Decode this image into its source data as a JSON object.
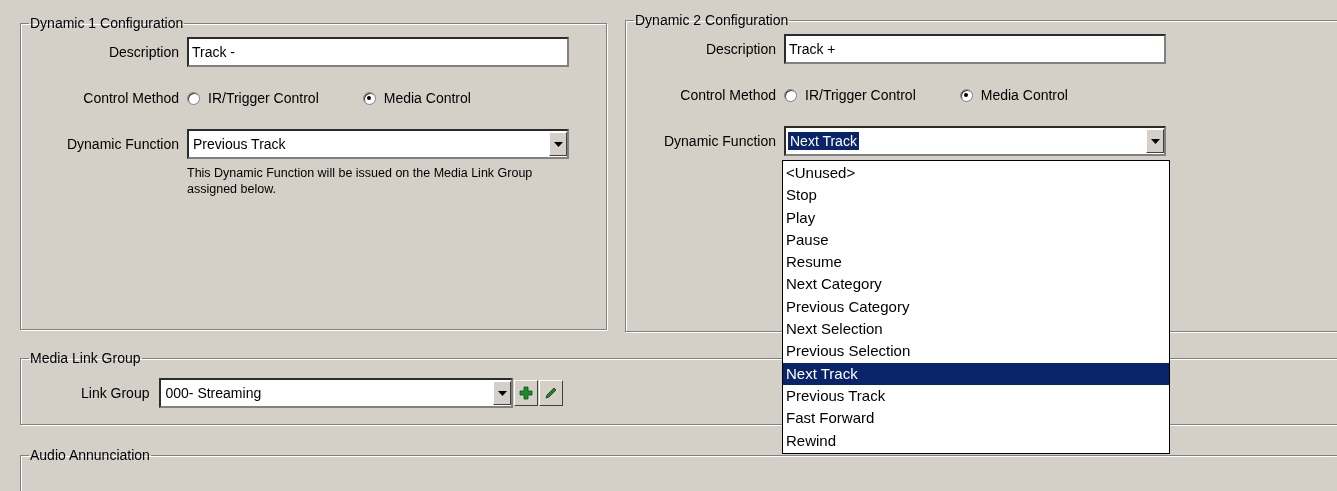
{
  "groups": [
    {
      "title": "Dynamic 1 Configuration",
      "description": {
        "label": "Description",
        "value": "Track -"
      },
      "control_method": {
        "label": "Control Method",
        "options": [
          {
            "label": "IR/Trigger Control",
            "selected": false
          },
          {
            "label": "Media Control",
            "selected": true
          }
        ]
      },
      "dynamic_function": {
        "label": "Dynamic Function",
        "value": "Previous Track",
        "highlighted": false
      },
      "note": "This Dynamic Function will be issued on the Media Link Group assigned below."
    },
    {
      "title": "Dynamic 2 Configuration",
      "description": {
        "label": "Description",
        "value": "Track +"
      },
      "control_method": {
        "label": "Control Method",
        "options": [
          {
            "label": "IR/Trigger Control",
            "selected": false
          },
          {
            "label": "Media Control",
            "selected": true
          }
        ]
      },
      "dynamic_function": {
        "label": "Dynamic Function",
        "value": "Next Track",
        "highlighted": true,
        "expanded": true,
        "items": [
          {
            "label": "<Unused>",
            "selected": false
          },
          {
            "label": "Stop",
            "selected": false
          },
          {
            "label": "Play",
            "selected": false
          },
          {
            "label": "Pause",
            "selected": false
          },
          {
            "label": "Resume",
            "selected": false
          },
          {
            "label": "Next Category",
            "selected": false
          },
          {
            "label": "Previous Category",
            "selected": false
          },
          {
            "label": "Next Selection",
            "selected": false
          },
          {
            "label": "Previous Selection",
            "selected": false
          },
          {
            "label": "Next Track",
            "selected": true
          },
          {
            "label": "Previous Track",
            "selected": false
          },
          {
            "label": "Fast Forward",
            "selected": false
          },
          {
            "label": "Rewind",
            "selected": false
          }
        ]
      }
    }
  ],
  "media_link_group": {
    "title": "Media Link Group",
    "link_group": {
      "label": "Link Group",
      "value": "000- Streaming"
    }
  },
  "audio_annunciation": {
    "title": "Audio Annunciation"
  }
}
